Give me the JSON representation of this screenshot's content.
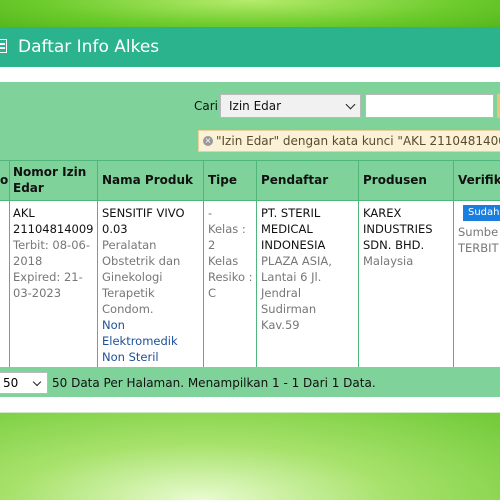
{
  "panel": {
    "title": "Daftar Info Alkes"
  },
  "search": {
    "label": "Cari",
    "category": "Izin Edar",
    "input_value": "",
    "filter_text": "\"Izin Edar\" dengan kata kunci \"AKL 21104814009\""
  },
  "table": {
    "headers": {
      "no": "o",
      "izin": "Nomor Izin Edar",
      "produk": "Nama Produk",
      "tipe": "Tipe",
      "pendaftar": "Pendaftar",
      "produsen": "Produsen",
      "verifikasi": "Verifika"
    },
    "row": {
      "izin_no": "AKL 21104814009",
      "terbit": "Terbit: 08-06-2018",
      "expired": "Expired: 21-03-2023",
      "produk_name": "SENSITIF VIVO 0.03",
      "produk_desc": "Peralatan Obstetrik dan Ginekologi Terapetik Condom.",
      "produk_cat": "Non Elektromedik Non Steril",
      "tipe_a": "-",
      "tipe_b": "Kelas : 2",
      "tipe_c": "Kelas Resiko : C",
      "pendaftar_name": "PT. STERIL MEDICAL INDONESIA",
      "pendaftar_addr": "PLAZA ASIA, Lantai 6 Jl. Jendral Sudirman Kav.59",
      "produsen_name": "KAREX INDUSTRIES SDN. BHD.",
      "produsen_country": "Malaysia",
      "badge": "Sudah",
      "sumber": "Sumbe",
      "terbit_status": "TERBIT"
    }
  },
  "pagination": {
    "per_page": "50",
    "summary": "50 Data Per Halaman. Menampilkan 1 - 1 Dari 1 Data."
  }
}
